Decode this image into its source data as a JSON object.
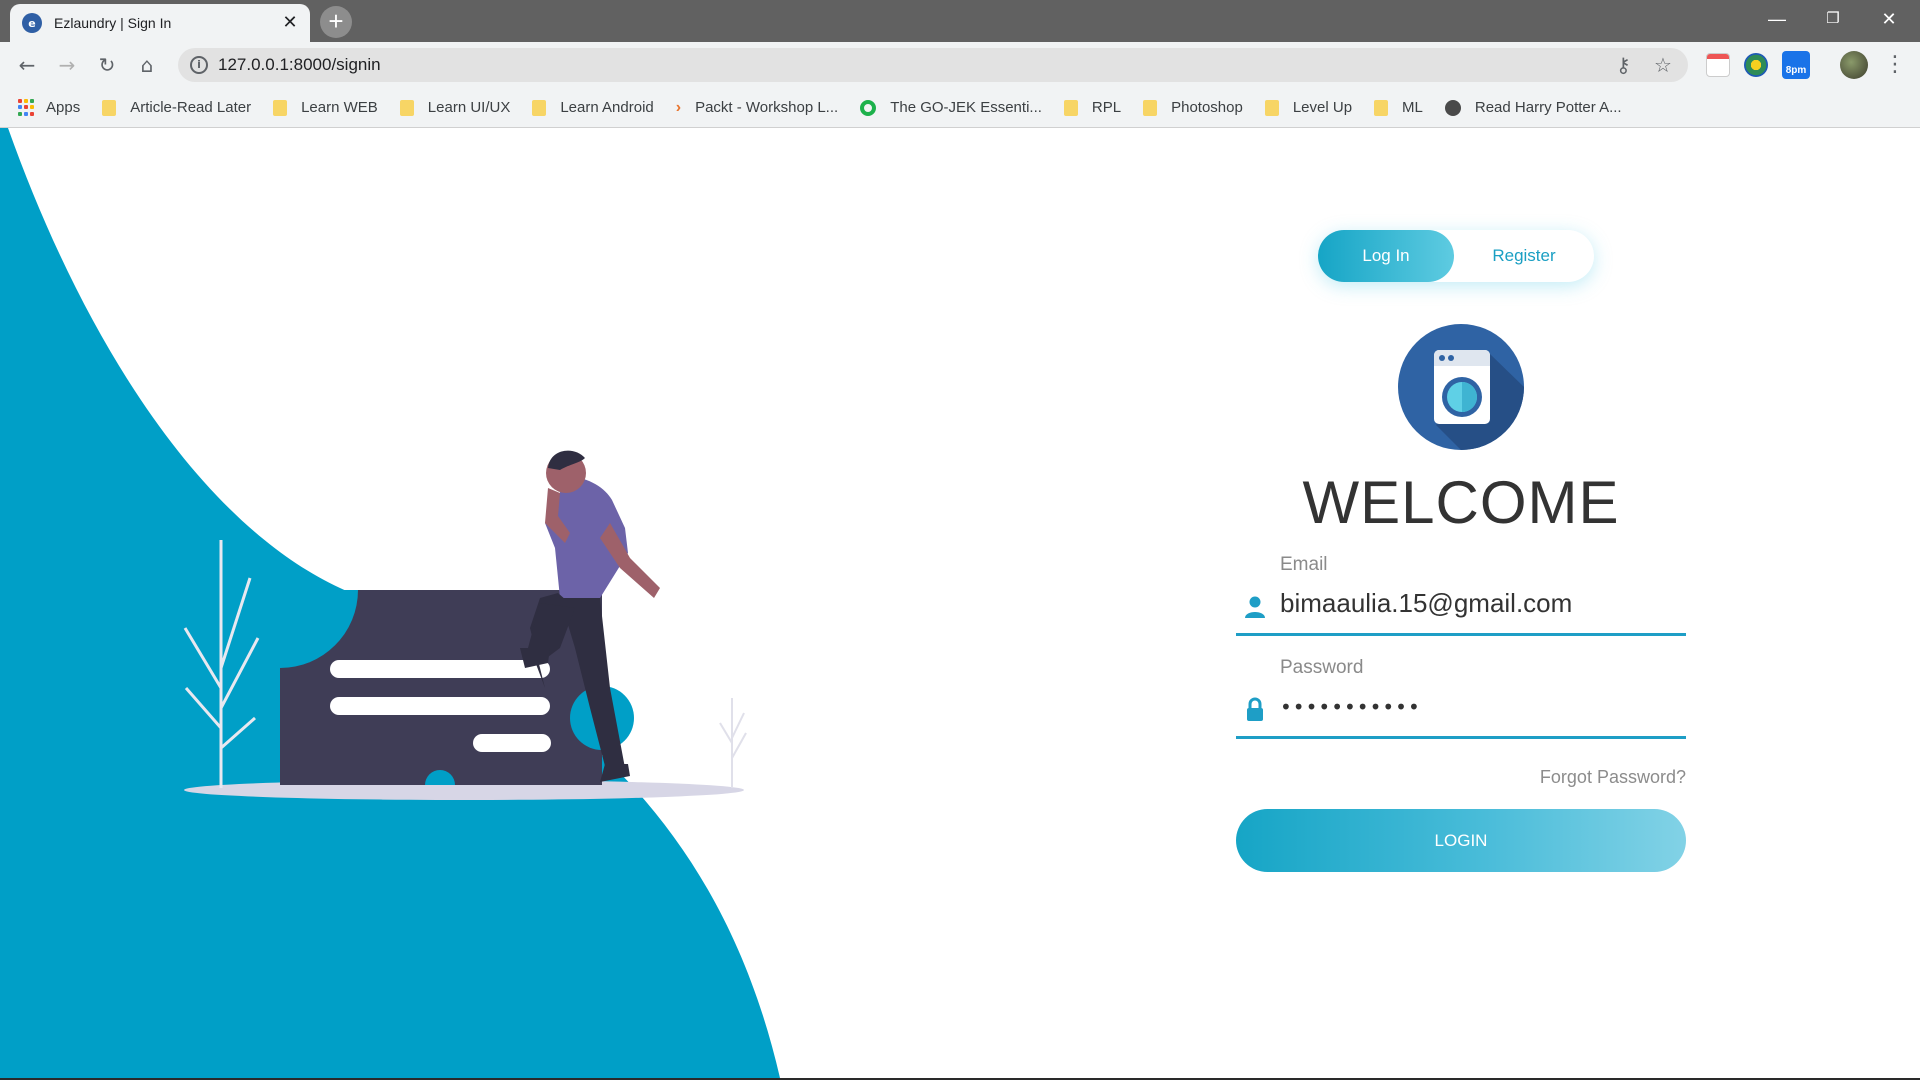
{
  "browser": {
    "tab_title": "Ezlaundry | Sign In",
    "tab_close": "✕",
    "new_tab": "+",
    "url": "127.0.0.1:8000/signin",
    "window_controls": {
      "minimize": "—",
      "restore": "❐",
      "close": "✕"
    },
    "extension_badge": "8pm"
  },
  "bookmarks": [
    {
      "label": "Apps",
      "icon": "apps-grid-icon"
    },
    {
      "label": "Article-Read Later",
      "icon": "folder-icon"
    },
    {
      "label": "Learn WEB",
      "icon": "folder-icon"
    },
    {
      "label": "Learn UI/UX",
      "icon": "folder-icon"
    },
    {
      "label": "Learn Android",
      "icon": "folder-icon"
    },
    {
      "label": "Packt - Workshop L...",
      "icon": "packt-icon"
    },
    {
      "label": "The GO-JEK Essenti...",
      "icon": "gojek-icon"
    },
    {
      "label": "RPL",
      "icon": "folder-icon"
    },
    {
      "label": "Photoshop",
      "icon": "folder-icon"
    },
    {
      "label": "Level Up",
      "icon": "folder-icon"
    },
    {
      "label": "ML",
      "icon": "folder-icon"
    },
    {
      "label": "Read Harry Potter A...",
      "icon": "globe-icon"
    }
  ],
  "auth_switch": {
    "login_label": "Log In",
    "register_label": "Register",
    "active": "login"
  },
  "welcome": "WELCOME",
  "email": {
    "label": "Email",
    "value": "bimaaulia.15@gmail.com"
  },
  "password": {
    "label": "Password",
    "value": "•••••••••••"
  },
  "forgot_password": "Forgot Password?",
  "login_button": "LOGIN",
  "colors": {
    "accent": "#1a9fc3",
    "wave": "#009fc7",
    "illustration_dark": "#3f3d56",
    "shirt": "#6c63a8"
  }
}
